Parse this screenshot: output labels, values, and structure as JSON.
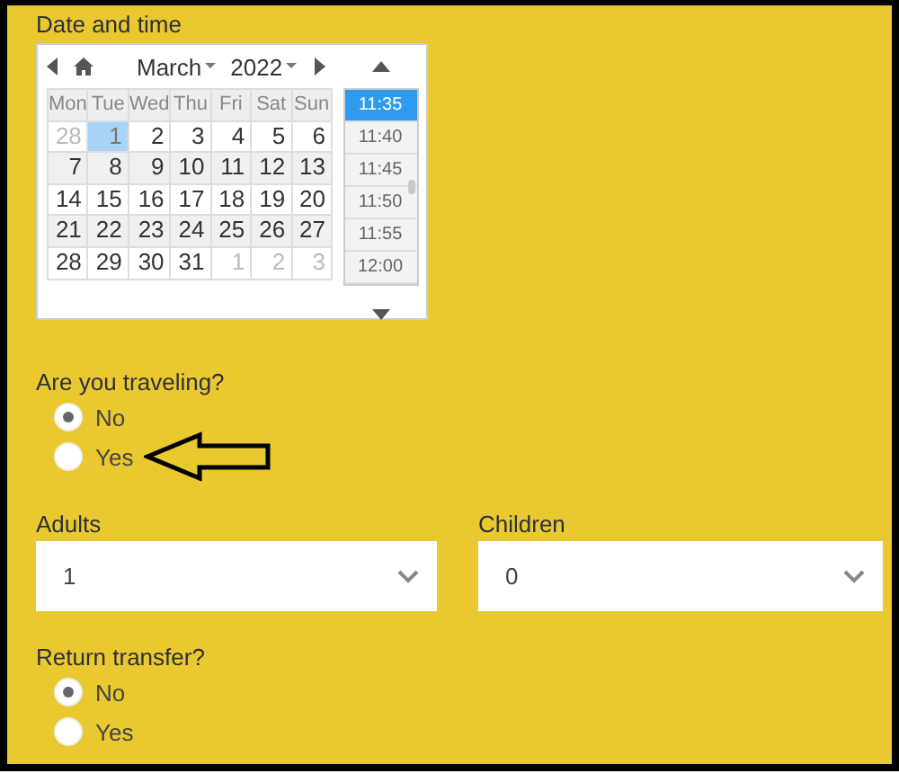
{
  "date_section": {
    "label": "Date and time",
    "calendar": {
      "month": "March",
      "year": "2022",
      "weekdays": [
        "Mon",
        "Tue",
        "Wed",
        "Thu",
        "Fri",
        "Sat",
        "Sun"
      ],
      "weeks": [
        [
          {
            "day": "28",
            "other_month": true,
            "selected": false
          },
          {
            "day": "1",
            "other_month": false,
            "selected": true
          },
          {
            "day": "2",
            "other_month": false,
            "selected": false
          },
          {
            "day": "3",
            "other_month": false,
            "selected": false
          },
          {
            "day": "4",
            "other_month": false,
            "selected": false
          },
          {
            "day": "5",
            "other_month": false,
            "selected": false
          },
          {
            "day": "6",
            "other_month": false,
            "selected": false
          }
        ],
        [
          {
            "day": "7",
            "other_month": false,
            "selected": false
          },
          {
            "day": "8",
            "other_month": false,
            "selected": false
          },
          {
            "day": "9",
            "other_month": false,
            "selected": false
          },
          {
            "day": "10",
            "other_month": false,
            "selected": false
          },
          {
            "day": "11",
            "other_month": false,
            "selected": false
          },
          {
            "day": "12",
            "other_month": false,
            "selected": false
          },
          {
            "day": "13",
            "other_month": false,
            "selected": false
          }
        ],
        [
          {
            "day": "14",
            "other_month": false,
            "selected": false
          },
          {
            "day": "15",
            "other_month": false,
            "selected": false
          },
          {
            "day": "16",
            "other_month": false,
            "selected": false
          },
          {
            "day": "17",
            "other_month": false,
            "selected": false
          },
          {
            "day": "18",
            "other_month": false,
            "selected": false
          },
          {
            "day": "19",
            "other_month": false,
            "selected": false
          },
          {
            "day": "20",
            "other_month": false,
            "selected": false
          }
        ],
        [
          {
            "day": "21",
            "other_month": false,
            "selected": false
          },
          {
            "day": "22",
            "other_month": false,
            "selected": false
          },
          {
            "day": "23",
            "other_month": false,
            "selected": false
          },
          {
            "day": "24",
            "other_month": false,
            "selected": false
          },
          {
            "day": "25",
            "other_month": false,
            "selected": false
          },
          {
            "day": "26",
            "other_month": false,
            "selected": false
          },
          {
            "day": "27",
            "other_month": false,
            "selected": false
          }
        ],
        [
          {
            "day": "28",
            "other_month": false,
            "selected": false
          },
          {
            "day": "29",
            "other_month": false,
            "selected": false
          },
          {
            "day": "30",
            "other_month": false,
            "selected": false
          },
          {
            "day": "31",
            "other_month": false,
            "selected": false
          },
          {
            "day": "1",
            "other_month": true,
            "selected": false
          },
          {
            "day": "2",
            "other_month": true,
            "selected": false
          },
          {
            "day": "3",
            "other_month": true,
            "selected": false
          }
        ]
      ],
      "times": [
        {
          "label": "11:35",
          "selected": true
        },
        {
          "label": "11:40",
          "selected": false
        },
        {
          "label": "11:45",
          "selected": false
        },
        {
          "label": "11:50",
          "selected": false
        },
        {
          "label": "11:55",
          "selected": false
        },
        {
          "label": "12:00",
          "selected": false
        }
      ]
    }
  },
  "traveling": {
    "question": "Are you traveling?",
    "options": [
      {
        "label": "No",
        "selected": true
      },
      {
        "label": "Yes",
        "selected": false
      }
    ]
  },
  "adults": {
    "label": "Adults",
    "value": "1"
  },
  "children": {
    "label": "Children",
    "value": "0"
  },
  "return_transfer": {
    "question": "Return transfer?",
    "options": [
      {
        "label": "No",
        "selected": true
      },
      {
        "label": "Yes",
        "selected": false
      }
    ]
  }
}
